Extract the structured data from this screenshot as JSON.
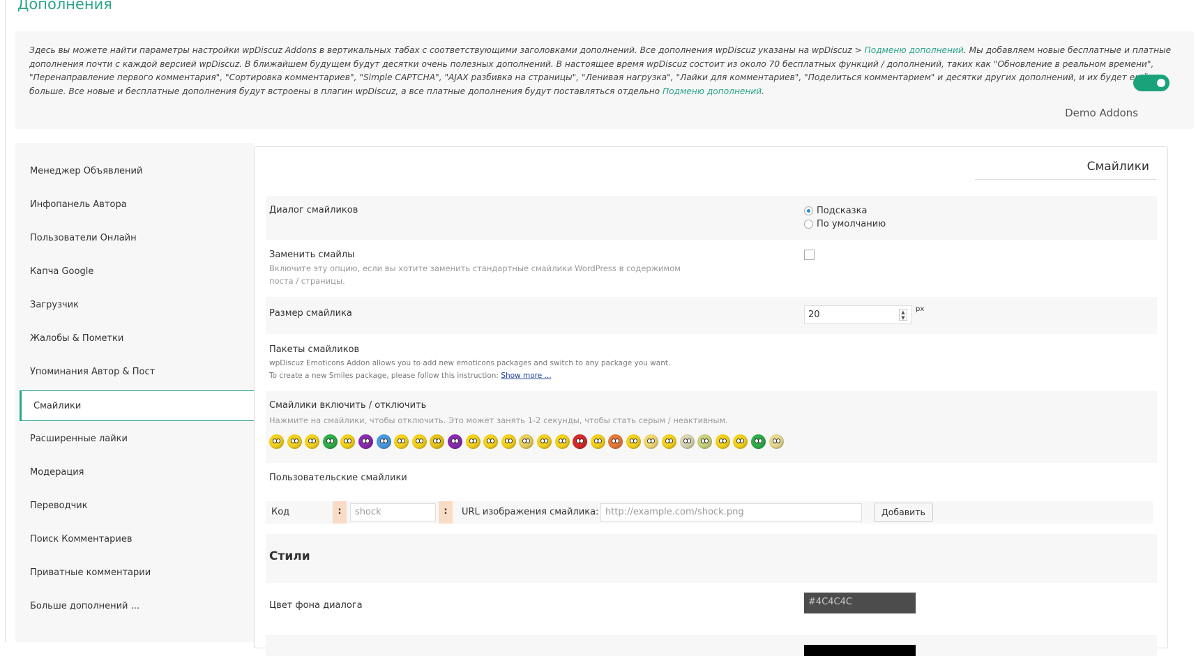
{
  "page": {
    "title": "Дополнения"
  },
  "intro": {
    "t1": "Здесь вы можете найти параметры настройки wpDiscuz Addons в вертикальных табах с соответствующими заголовками дополнений. Все дополнения wpDiscuz указаны на wpDiscuz > ",
    "link1": "Подменю дополнений",
    "t2": ". Мы добавляем новые бесплатные и платные дополнения почти с каждой версией wpDiscuz. В ближайшем будущем будут десятки очень полезных дополнений. В настоящее время wpDiscuz состоит из около 70 бесплатных функций / дополнений, таких как \"Обновление в реальном времени\", \"Перенаправление первого комментария\", \"Сортировка комментариев\", \"Simple CAPTCHA\", \"AJAX разбивка на страницы\", \"Ленивая нагрузка\", \"Лайки для комментариев\", \"Поделиться комментарием\" и десятки других дополнений, и их будет ещё больше. Все новые и бесплатные дополнения будут встроены в плагин wpDiscuz, а все платные дополнения будут поставляться отдельно ",
    "link2": "Подменю дополнений",
    "t3": "."
  },
  "demo": {
    "label": "Demo Addons",
    "enabled": true
  },
  "sidebar": {
    "items": [
      {
        "label": "Менеджер Объявлений"
      },
      {
        "label": "Инфопанель Автора"
      },
      {
        "label": "Пользователи Онлайн"
      },
      {
        "label": "Капча Google"
      },
      {
        "label": "Загрузчик"
      },
      {
        "label": "Жалобы & Пометки"
      },
      {
        "label": "Упоминания Автор & Пост"
      },
      {
        "label": "Смайлики"
      },
      {
        "label": "Расширенные лайки"
      },
      {
        "label": "Модерация"
      },
      {
        "label": "Переводчик"
      },
      {
        "label": "Поиск Комментариев"
      },
      {
        "label": "Приватные комментарии"
      },
      {
        "label": "Больше дополнений ..."
      }
    ],
    "active": "Смайлики"
  },
  "panel": {
    "title": "Смайлики",
    "dialog": {
      "label": "Диалог смайликов",
      "options": [
        "Подсказка",
        "По умолчанию"
      ],
      "selected": "Подсказка"
    },
    "replace": {
      "label": "Заменить смайлы",
      "desc1": "Включите эту опцию, если вы хотите заменить стандартные смайлики WordPress в содержимом",
      "desc2": "поста / страницы.",
      "checked": false
    },
    "size": {
      "label": "Размер смайлика",
      "value": "20",
      "unit": "px"
    },
    "packages": {
      "label": "Пакеты смайликов",
      "desc1": "wpDiscuz Emoticons Addon allows you to add new emoticons packages and switch to any package you want.",
      "desc2": "To create a new Smiles package, please follow this instruction: ",
      "link": "Show more ..."
    },
    "toggle": {
      "label": "Смайлики включить / отключить",
      "desc": "Нажмите на смайлики, чтобы отключить. Это может занять 1-2 секунды, чтобы стать серым / неактивным.",
      "colors": [
        "#f5d21c",
        "#f5d21c",
        "#f5d21c",
        "#2fae4a",
        "#f5d21c",
        "#8a2cb0",
        "#4a9be0",
        "#f5d21c",
        "#f5d21c",
        "#e8c21a",
        "#8a2cb0",
        "#f5d21c",
        "#f5d21c",
        "#f5d21c",
        "#e8d05a",
        "#f5d21c",
        "#f5d21c",
        "#d42a2a",
        "#f5d21c",
        "#e8783a",
        "#f5d21c",
        "#f0d870",
        "#f5d21c",
        "#d8d4b0",
        "#c8d27a",
        "#f5d21c",
        "#f5d21c",
        "#2fae4a",
        "#e8d890"
      ]
    },
    "custom": {
      "label": "Пользовательские смайлики",
      "code_label": "Код",
      "colon": ":",
      "code_placeholder": "shock",
      "url_label": "URL изображения смайлика:",
      "url_placeholder": "http://example.com/shock.png",
      "add": "Добавить"
    },
    "styles": {
      "heading": "Стили",
      "bg_label": "Цвет фона диалога",
      "bg_value": "#4C4C4C"
    }
  }
}
